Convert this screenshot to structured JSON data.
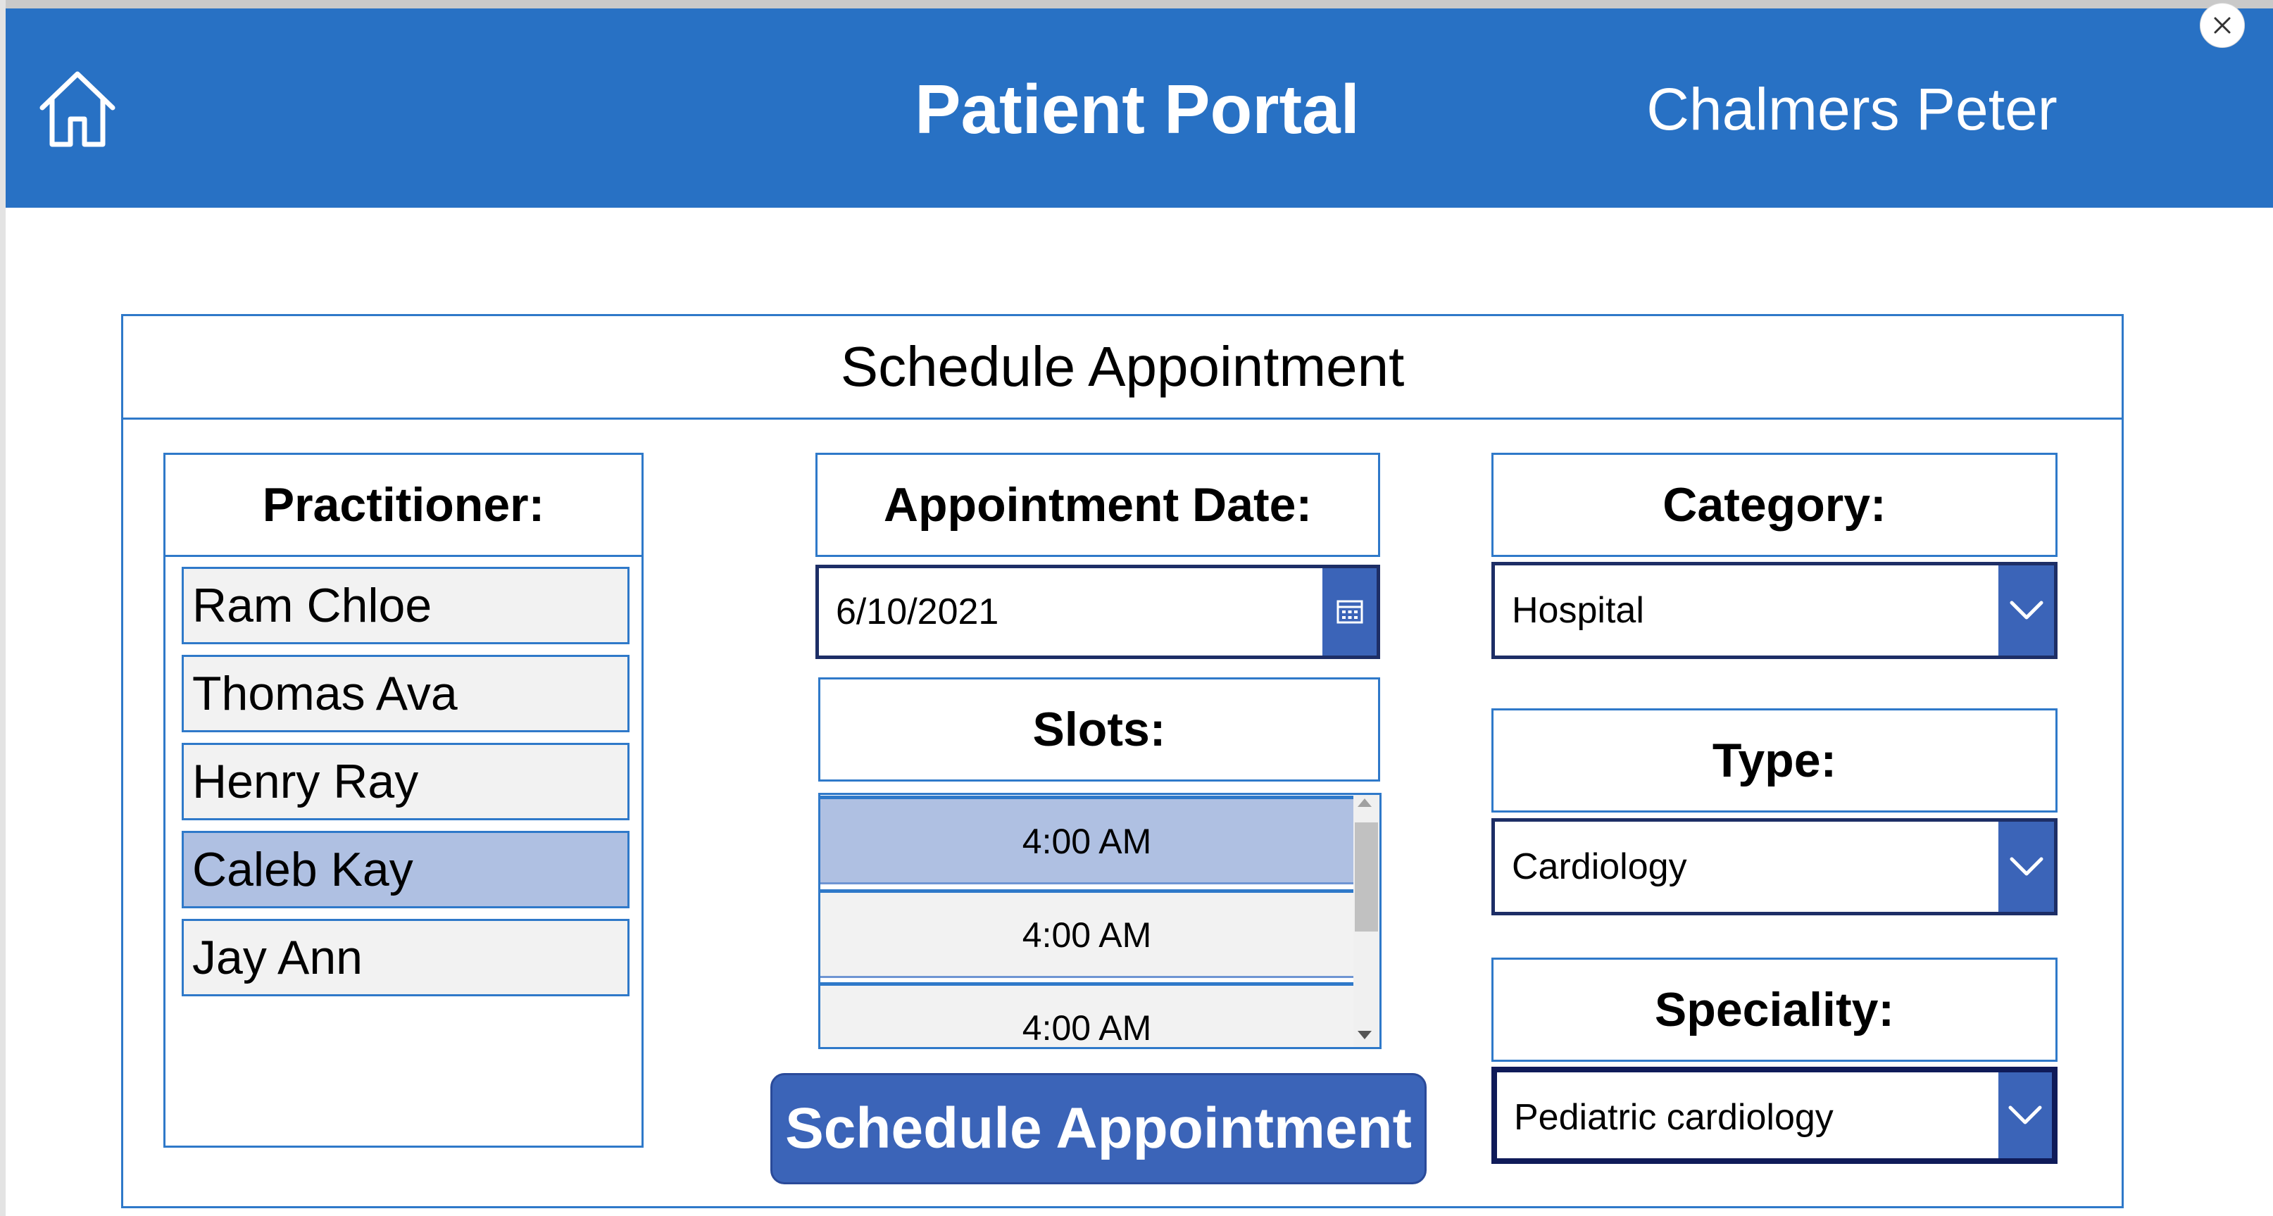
{
  "header": {
    "title": "Patient Portal",
    "user_name": "Chalmers Peter",
    "background_color": "#2871c4"
  },
  "icons": {
    "home": "home-icon",
    "close": "close-icon",
    "calendar": "calendar-icon",
    "chevron": "chevron-down-icon"
  },
  "panel": {
    "title": "Schedule Appointment"
  },
  "practitioner": {
    "label": "Practitioner:",
    "items": [
      "Ram Chloe",
      "Thomas Ava",
      "Henry Ray",
      "Caleb Kay",
      "Jay Ann"
    ],
    "selected": "Caleb Kay"
  },
  "appointment_date": {
    "label": "Appointment Date:",
    "value": "6/10/2021"
  },
  "slots": {
    "label": "Slots:",
    "items": [
      "4:00 AM",
      "4:00 AM",
      "4:00 AM"
    ],
    "selected_index": 0
  },
  "schedule_button": {
    "label": "Schedule Appointment"
  },
  "category": {
    "label": "Category:",
    "value": "Hospital"
  },
  "type": {
    "label": "Type:",
    "value": "Cardiology"
  },
  "speciality": {
    "label": "Speciality:",
    "value": "Pediatric cardiology"
  },
  "colors": {
    "accent": "#3b64b8",
    "border": "#2f79c9",
    "selected": "#afc0e2",
    "item_bg": "#f2f2f2"
  }
}
